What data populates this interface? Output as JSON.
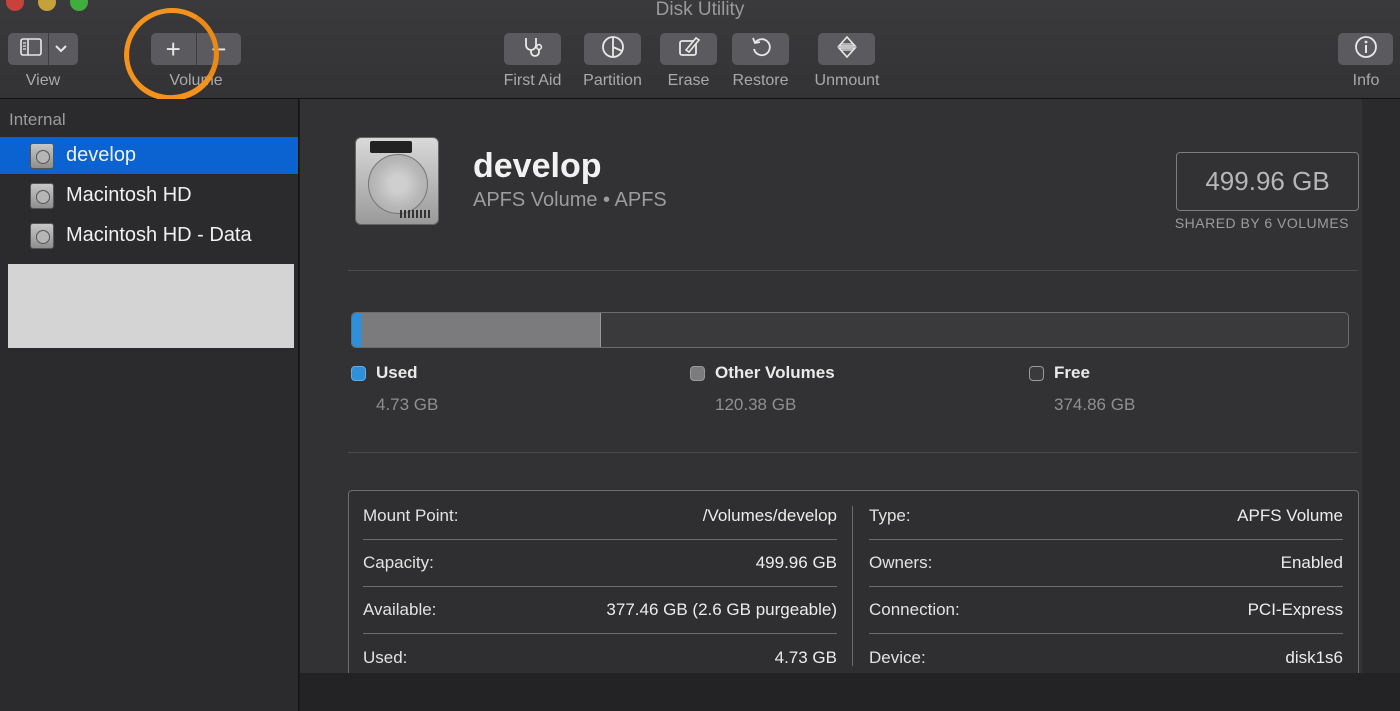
{
  "window": {
    "title": "Disk Utility"
  },
  "toolbar": {
    "view": {
      "label": "View"
    },
    "volume": {
      "label": "Volume",
      "add": "+",
      "remove": "−"
    },
    "buttons": [
      {
        "label": "First Aid",
        "icon": "stethoscope-icon"
      },
      {
        "label": "Partition",
        "icon": "pie-icon"
      },
      {
        "label": "Erase",
        "icon": "erase-icon"
      },
      {
        "label": "Restore",
        "icon": "restore-icon"
      },
      {
        "label": "Unmount",
        "icon": "unmount-icon"
      }
    ],
    "info": {
      "label": "Info",
      "icon": "info-icon"
    }
  },
  "sidebar": {
    "section": "Internal",
    "items": [
      {
        "label": "develop"
      },
      {
        "label": "Macintosh HD"
      },
      {
        "label": "Macintosh HD - Data"
      }
    ]
  },
  "volume": {
    "name": "develop",
    "subtitle": "APFS Volume • APFS",
    "size": "499.96 GB",
    "size_caption": "SHARED BY 6 VOLUMES"
  },
  "usage": {
    "used": {
      "label": "Used",
      "value": "4.73 GB",
      "color": "#2f8fd8",
      "fraction": 0.0095
    },
    "other": {
      "label": "Other Volumes",
      "value": "120.38 GB",
      "color": "#7b7b7d",
      "fraction": 0.2408
    },
    "free": {
      "label": "Free",
      "value": "374.86 GB",
      "color": "#3a3a3c",
      "fraction": 0.7497
    }
  },
  "details": {
    "left": [
      {
        "key": "Mount Point:",
        "value": "/Volumes/develop"
      },
      {
        "key": "Capacity:",
        "value": "499.96 GB"
      },
      {
        "key": "Available:",
        "value": "377.46 GB (2.6 GB purgeable)"
      },
      {
        "key": "Used:",
        "value": "4.73 GB"
      }
    ],
    "right": [
      {
        "key": "Type:",
        "value": "APFS Volume"
      },
      {
        "key": "Owners:",
        "value": "Enabled"
      },
      {
        "key": "Connection:",
        "value": "PCI-Express"
      },
      {
        "key": "Device:",
        "value": "disk1s6"
      }
    ]
  }
}
